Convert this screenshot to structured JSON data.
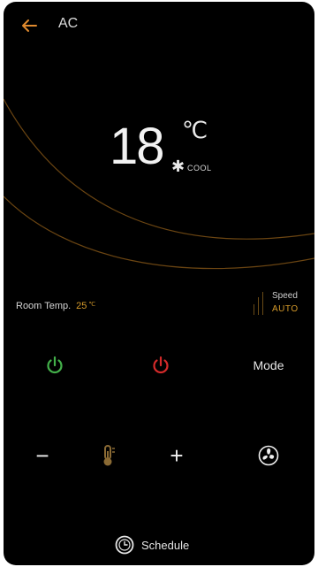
{
  "header": {
    "title": "AC",
    "back_icon": "back-arrow-icon"
  },
  "display": {
    "set_temperature": "18",
    "unit": "℃",
    "mode": "COOL",
    "mode_icon": "snowflake-icon"
  },
  "room": {
    "label": "Room Temp.",
    "value": "25",
    "unit": "℃"
  },
  "speed": {
    "label": "Speed",
    "value": "AUTO"
  },
  "controls": {
    "power_on_icon": "power-icon",
    "power_off_icon": "power-icon",
    "mode_label": "Mode",
    "minus_label": "−",
    "plus_label": "+",
    "thermo_icon": "thermometer-icon",
    "fan_icon": "fan-icon"
  },
  "footer": {
    "schedule_label": "Schedule",
    "schedule_icon": "clock-icon"
  },
  "colors": {
    "background": "#000000",
    "accent_orange": "#d59a2a",
    "power_green": "#43b04a",
    "power_red": "#d42a2a",
    "arc_orange": "#7a4d12"
  }
}
